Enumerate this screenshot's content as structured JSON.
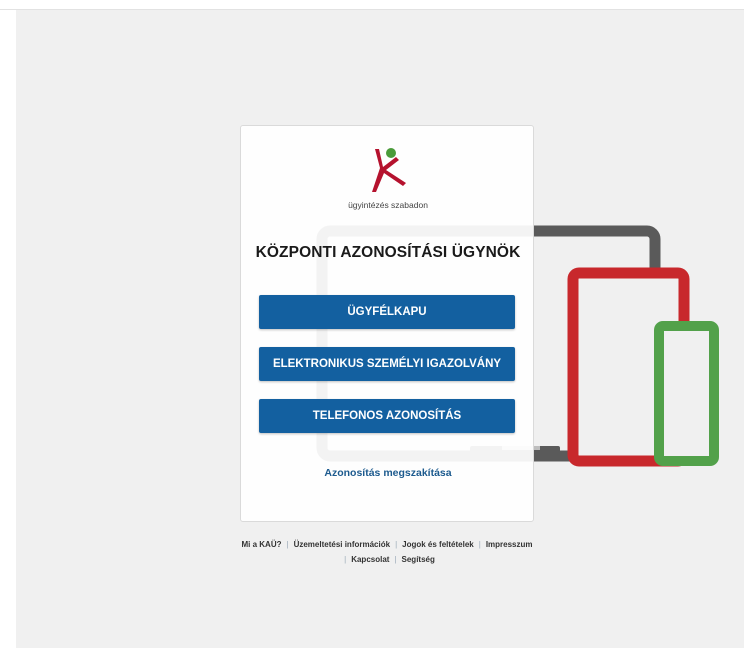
{
  "logo": {
    "tagline": "ügyintézés szabadon"
  },
  "title": "KÖZPONTI AZONOSÍTÁSI ÜGYNÖK",
  "buttons": {
    "ugyfelkapu": "ÜGYFÉLKAPU",
    "eszemelyi": "ELEKTRONIKUS SZEMÉLYI IGAZOLVÁNY",
    "telefonos": "TELEFONOS AZONOSÍTÁS"
  },
  "cancel_link": "Azonosítás megszakítása",
  "footer": {
    "mi_a_kau": "Mi a KAÜ?",
    "uzemeltetesi": "Üzemeltetési információk",
    "jogok": "Jogok és feltételek",
    "impresszum": "Impresszum",
    "kapcsolat": "Kapcsolat",
    "segitseg": "Segítség"
  },
  "colors": {
    "button_blue": "#1360a0",
    "link_blue": "#1c5a8e",
    "laptop_gray": "#5a5a5a",
    "tablet_red": "#c8282c",
    "phone_green": "#52a14a",
    "logo_red": "#b5122e",
    "logo_green": "#4a9b3a"
  }
}
